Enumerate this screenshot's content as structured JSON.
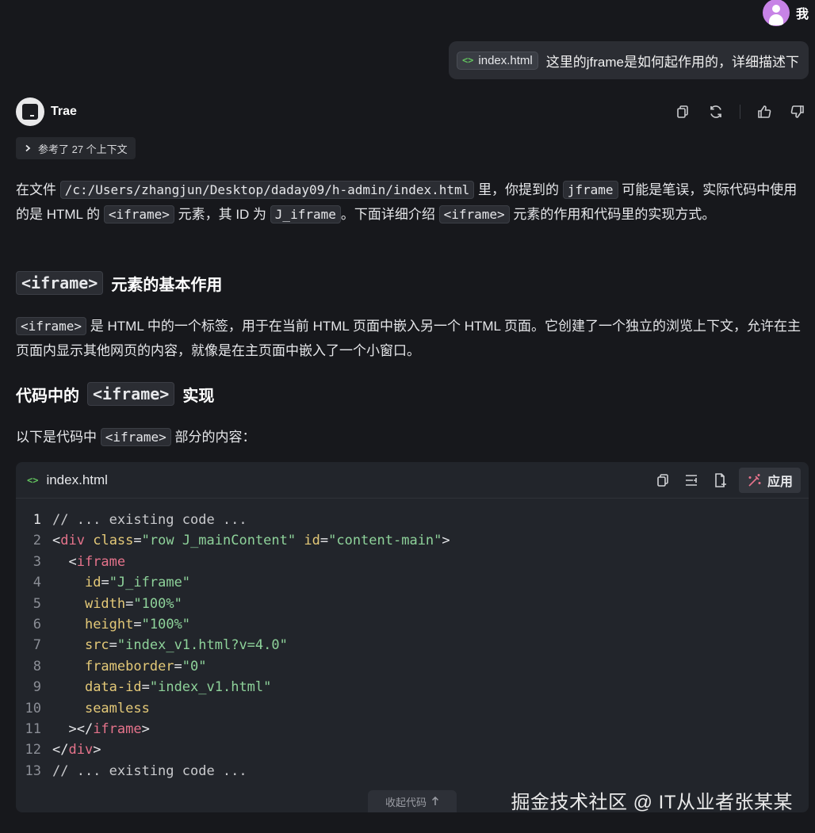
{
  "user": {
    "name": "我"
  },
  "user_message": {
    "file_chip": "index.html",
    "text": "这里的jframe是如何起作用的，详细描述下"
  },
  "assistant": {
    "name": "Trae",
    "context_label": "参考了 27 个上下文"
  },
  "answer": {
    "intro": {
      "t1": "在文件 ",
      "path": "/c:/Users/zhangjun/Desktop/daday09/h-admin/index.html",
      "t2": " 里，你提到的 ",
      "jframe": "jframe",
      "t3": " 可能是笔误，实际代码中使用的是 HTML 的 ",
      "iframe": "<iframe>",
      "t4": " 元素，其 ID 为 ",
      "id": "J_iframe",
      "t5": "。下面详细介绍 ",
      "iframe2": "<iframe>",
      "t6": " 元素的作用和代码里的实现方式。"
    },
    "section1": {
      "heading_code": "<iframe>",
      "heading_text": "元素的基本作用",
      "code": "<iframe>",
      "body": " 是 HTML 中的一个标签，用于在当前 HTML 页面中嵌入另一个 HTML 页面。它创建了一个独立的浏览上下文，允许在主页面内显示其他网页的内容，就像是在主页面中嵌入了一个小窗口。"
    },
    "section2": {
      "heading_pre": "代码中的",
      "heading_code": "<iframe>",
      "heading_text": "实现",
      "lead_pre": "以下是代码中 ",
      "lead_code": "<iframe>",
      "lead_post": " 部分的内容："
    }
  },
  "code_block": {
    "filename": "index.html",
    "apply_label": "应用",
    "collapse_label": "收起代码",
    "line_numbers": [
      "1",
      "2",
      "3",
      "4",
      "5",
      "6",
      "7",
      "8",
      "9",
      "10",
      "11",
      "12",
      "13"
    ]
  },
  "watermark": "掘金技术社区 @ IT从业者张某某",
  "colors": {
    "background": "#17181c",
    "panel": "#22252b",
    "tag": "#e5738b",
    "attribute": "#e4c978",
    "string": "#8ed29a",
    "file_icon": "#62c25e",
    "avatar": "#c783e6"
  },
  "icons": [
    "user-avatar-icon",
    "code-file-icon",
    "copy-icon",
    "regenerate-icon",
    "thumbs-up-icon",
    "thumbs-down-icon",
    "chevron-right-icon",
    "insert-icon",
    "add-file-icon",
    "magic-wand-icon",
    "arrow-up-icon"
  ]
}
